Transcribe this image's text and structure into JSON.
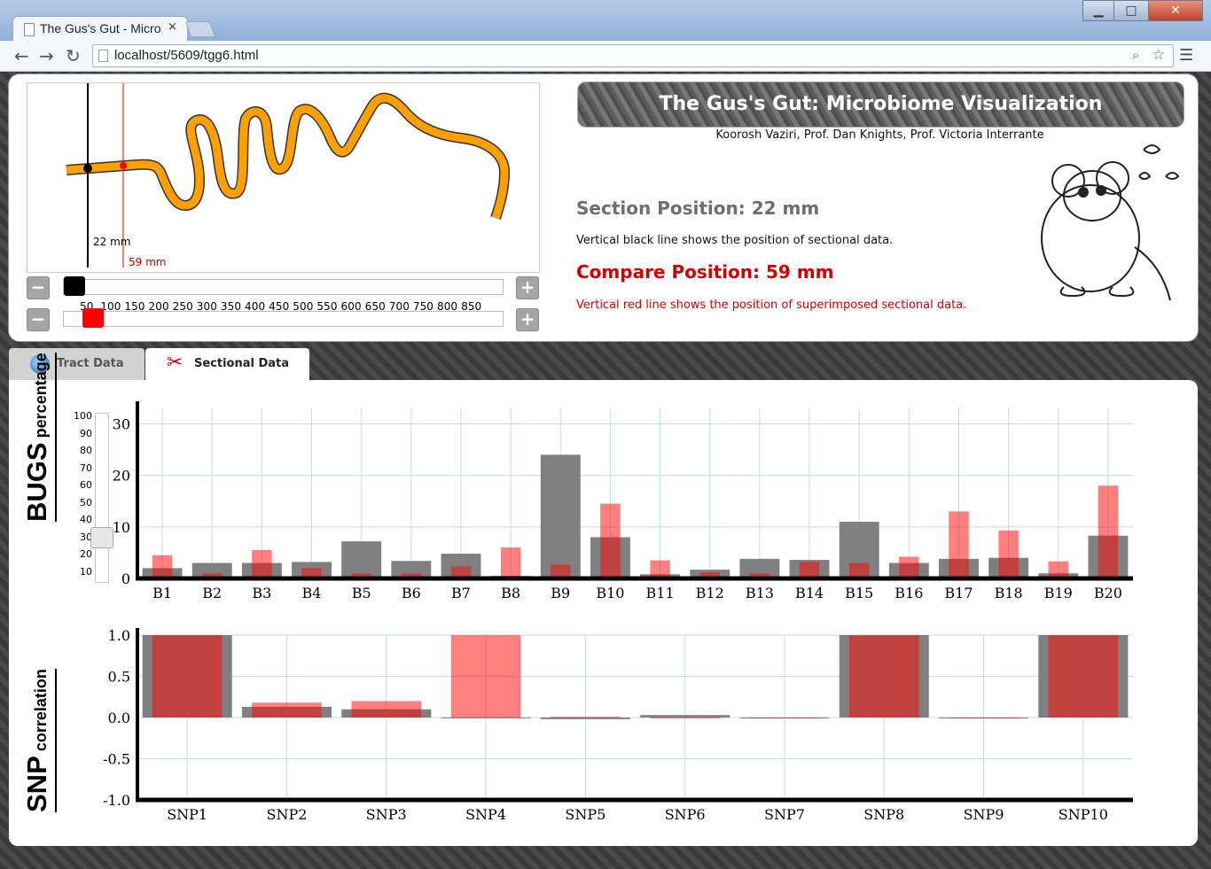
{
  "browser": {
    "tab_title": "The Gus's Gut - Micro",
    "tab_close": "×",
    "url": "localhost/5609/tgg6.html"
  },
  "tract": {
    "section_label": "22 mm",
    "compare_label": "59 mm",
    "section_fraction": 0.02,
    "compare_fraction": 0.067,
    "ticks": "50  100 150 200 250 300 350 400 450 500 550 600 650 700 750 800 850"
  },
  "header": {
    "title": "The Gus's Gut: Microbiome Visualization",
    "authors": "Koorosh Vaziri, Prof. Dan Knights, Prof. Victoria Interrante"
  },
  "info": {
    "section_position": "Section Position: 22 mm",
    "section_desc": "Vertical black line shows the position of sectional data.",
    "compare_position": "Compare Position: 59 mm",
    "compare_desc": "Vertical red line shows the position of superimposed sectional data."
  },
  "tabs": [
    {
      "label": "Tract Data",
      "icon": "globe-icon"
    },
    {
      "label": "Sectional Data",
      "icon": "scissors-icon"
    }
  ],
  "bugs_title": {
    "big": "BUGS",
    "small": "percentage"
  },
  "snp_title": {
    "big": "SNP",
    "small": "correlation"
  },
  "percentage_slider": {
    "ticks": [
      "100",
      "90",
      "80",
      "70",
      "60",
      "50",
      "40",
      "30",
      "20",
      "10"
    ],
    "value": 25
  },
  "colors": {
    "section": "#808080",
    "compare": "#ff0000"
  },
  "chart_data": [
    {
      "type": "bar",
      "categories": [
        "B1",
        "B2",
        "B3",
        "B4",
        "B5",
        "B6",
        "B7",
        "B8",
        "B9",
        "B10",
        "B11",
        "B12",
        "B13",
        "B14",
        "B15",
        "B16",
        "B17",
        "B18",
        "B19",
        "B20"
      ],
      "series": [
        {
          "values": [
            2,
            3,
            3,
            3.2,
            7.2,
            3.4,
            4.8,
            0.5,
            24,
            8,
            0.8,
            1.7,
            3.8,
            3.6,
            11,
            3,
            3.8,
            4,
            1,
            8.3
          ]
        },
        {
          "values": [
            4.5,
            1,
            5.5,
            2,
            1,
            1,
            2.3,
            6,
            2.7,
            14.5,
            3.5,
            1.2,
            1,
            3.2,
            3,
            4.2,
            13,
            9.3,
            3.3,
            18
          ]
        }
      ],
      "ylim": [
        0,
        33
      ],
      "yticks": [
        0,
        10,
        20,
        30
      ]
    },
    {
      "type": "bar",
      "categories": [
        "SNP1",
        "SNP2",
        "SNP3",
        "SNP4",
        "SNP5",
        "SNP6",
        "SNP7",
        "SNP8",
        "SNP9",
        "SNP10"
      ],
      "series": [
        {
          "values": [
            1.0,
            0.13,
            0.1,
            0.0,
            -0.02,
            0.03,
            0.0,
            1.0,
            0.0,
            1.0
          ]
        },
        {
          "values": [
            1.0,
            0.18,
            0.2,
            1.0,
            0.01,
            0.0,
            -0.01,
            1.0,
            -0.01,
            1.0
          ]
        }
      ],
      "ylim": [
        -1.0,
        1.0
      ],
      "yticks": [
        "-1.0",
        "-0.5",
        "0.0",
        "0.5",
        "1.0"
      ]
    }
  ]
}
